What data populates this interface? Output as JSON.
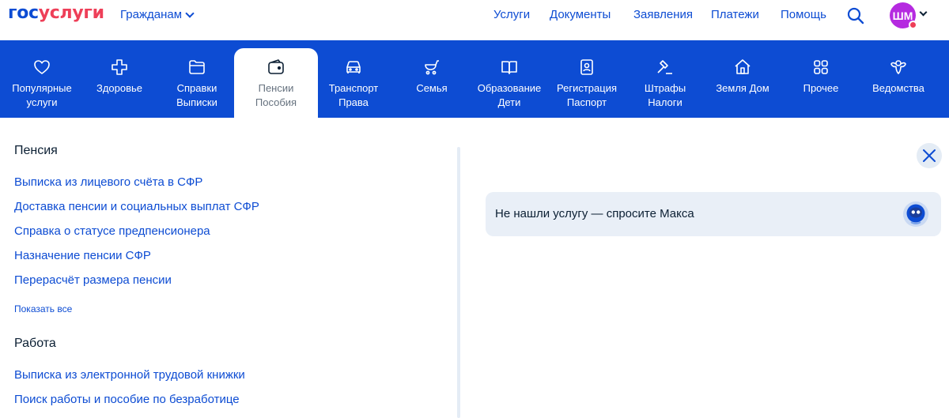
{
  "header": {
    "logo_part1": "гос",
    "logo_part2": "услуги",
    "audience_label": "Гражданам",
    "nav": [
      "Услуги",
      "Документы",
      "Заявления",
      "Платежи",
      "Помощь"
    ],
    "avatar_initials": "ШМ",
    "icons": {
      "search": "search-icon",
      "avatar_status": "notification-dot"
    }
  },
  "categories": [
    {
      "label": "Популярные\nуслуги",
      "icon": "heart-icon"
    },
    {
      "label": "Здоровье",
      "icon": "medical-cross-icon"
    },
    {
      "label": "Справки\nВыписки",
      "icon": "folder-icon"
    },
    {
      "label": "Пенсии\nПособия",
      "icon": "wallet-icon",
      "active": true
    },
    {
      "label": "Транспорт\nПрава",
      "icon": "car-icon"
    },
    {
      "label": "Семья",
      "icon": "stroller-icon"
    },
    {
      "label": "Образование\nДети",
      "icon": "book-icon"
    },
    {
      "label": "Регистрация\nПаспорт",
      "icon": "passport-icon"
    },
    {
      "label": "Штрафы\nНалоги",
      "icon": "gavel-icon"
    },
    {
      "label": "Земля Дом",
      "icon": "house-icon"
    },
    {
      "label": "Прочее",
      "icon": "grid-icon"
    },
    {
      "label": "Ведомства",
      "icon": "emblem-icon"
    }
  ],
  "menu": {
    "pension": {
      "title": "Пенсия",
      "links": [
        "Выписка из лицевого счёта в СФР",
        "Доставка пенсии и социальных выплат СФР",
        "Справка о статусе предпенсионера",
        "Назначение пенсии СФР",
        "Перерасчёт размера пенсии"
      ],
      "show_all": "Показать все"
    },
    "work": {
      "title": "Работа",
      "links": [
        "Выписка из электронной трудовой книжки",
        "Поиск работы и пособие по безработице"
      ]
    }
  },
  "help": {
    "text": "Не нашли услугу — спросите Макса",
    "icon": "robot-assistant-icon"
  },
  "colors": {
    "brand_blue": "#0d4cd3",
    "brand_red": "#ee3f58",
    "avatar": "#b52ae0",
    "card_bg": "#e9eff7"
  }
}
